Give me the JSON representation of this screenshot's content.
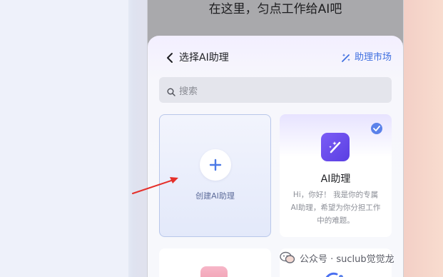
{
  "hint": {
    "text": "在这里，匀点工作给AI吧"
  },
  "sheet": {
    "title": "选择AI助理",
    "market_label": "助理市场",
    "search_placeholder": "搜索"
  },
  "cards": {
    "create_label": "创建AI助理",
    "assistant_name": "AI助理",
    "assistant_desc": "Hi，你好！ 我是你的专属AI助理，希望为你分担工作中的难题。",
    "assistant_selected": true
  },
  "watermark": {
    "text": "公众号 · suclub觉觉龙"
  },
  "colors": {
    "accent": "#3f6fe0",
    "arrow": "#e5302a",
    "ai_logo": "#6a4cf0"
  },
  "icons": [
    "back-icon",
    "market-icon",
    "search-icon",
    "plus-icon",
    "check-icon",
    "ai-logo-icon",
    "wechat-icon",
    "pointer-arrow"
  ]
}
